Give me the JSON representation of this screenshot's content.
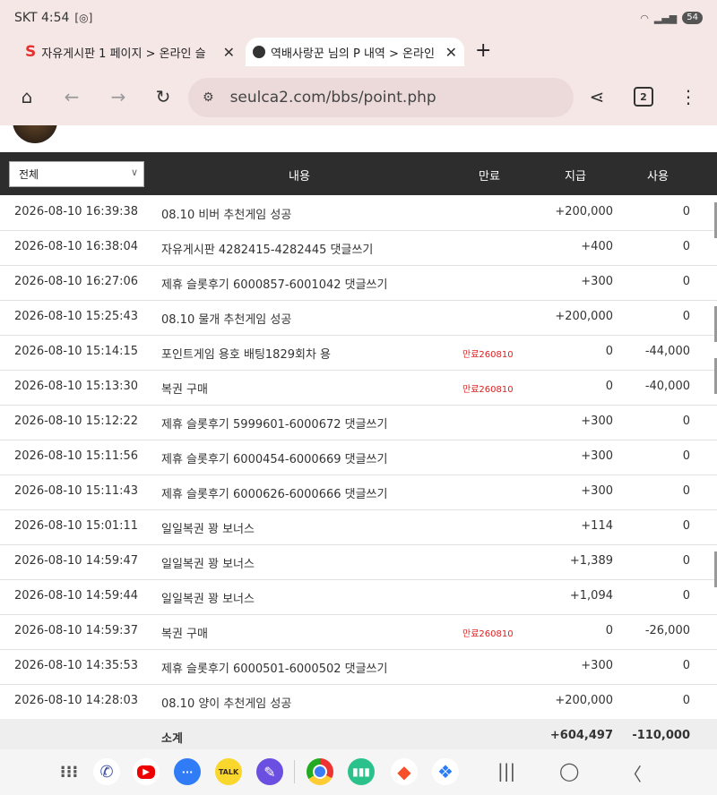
{
  "status": {
    "carrier_time": "SKT 4:54",
    "battery": "54"
  },
  "tabs": [
    {
      "title": "자유게시판 1 페이지 > 온라인 슬",
      "close": "✕"
    },
    {
      "title": "역배사랑꾼 님의 P 내역 > 온라인",
      "close": "✕"
    }
  ],
  "newtab": "+",
  "toolbar": {
    "url": "seulca2.com/bbs/point.php",
    "tab_count": "2"
  },
  "table": {
    "filter_selected": "전체",
    "headers": {
      "desc": "내용",
      "expire": "만료",
      "give": "지급",
      "use": "사용"
    },
    "rows": [
      {
        "date": "2026-08-10 16:39:38",
        "desc": "08.10 비버 추천게임 성공",
        "expire": "",
        "give": "+200,000",
        "use": "0"
      },
      {
        "date": "2026-08-10 16:38:04",
        "desc": "자유게시판 4282415-4282445 댓글쓰기",
        "expire": "",
        "give": "+400",
        "use": "0"
      },
      {
        "date": "2026-08-10 16:27:06",
        "desc": "제휴 슬롯후기 6000857-6001042 댓글쓰기",
        "expire": "",
        "give": "+300",
        "use": "0"
      },
      {
        "date": "2026-08-10 15:25:43",
        "desc": "08.10 물개 추천게임 성공",
        "expire": "",
        "give": "+200,000",
        "use": "0"
      },
      {
        "date": "2026-08-10 15:14:15",
        "desc": "포인트게임 용호 배팅1829회차 용",
        "expire": "만료260810",
        "give": "0",
        "use": "-44,000"
      },
      {
        "date": "2026-08-10 15:13:30",
        "desc": "복권 구매",
        "expire": "만료260810",
        "give": "0",
        "use": "-40,000"
      },
      {
        "date": "2026-08-10 15:12:22",
        "desc": "제휴 슬롯후기 5999601-6000672 댓글쓰기",
        "expire": "",
        "give": "+300",
        "use": "0"
      },
      {
        "date": "2026-08-10 15:11:56",
        "desc": "제휴 슬롯후기 6000454-6000669 댓글쓰기",
        "expire": "",
        "give": "+300",
        "use": "0"
      },
      {
        "date": "2026-08-10 15:11:43",
        "desc": "제휴 슬롯후기 6000626-6000666 댓글쓰기",
        "expire": "",
        "give": "+300",
        "use": "0"
      },
      {
        "date": "2026-08-10 15:01:11",
        "desc": "일일복권 꽝 보너스",
        "expire": "",
        "give": "+114",
        "use": "0"
      },
      {
        "date": "2026-08-10 14:59:47",
        "desc": "일일복권 꽝 보너스",
        "expire": "",
        "give": "+1,389",
        "use": "0"
      },
      {
        "date": "2026-08-10 14:59:44",
        "desc": "일일복권 꽝 보너스",
        "expire": "",
        "give": "+1,094",
        "use": "0"
      },
      {
        "date": "2026-08-10 14:59:37",
        "desc": "복권 구매",
        "expire": "만료260810",
        "give": "0",
        "use": "-26,000"
      },
      {
        "date": "2026-08-10 14:35:53",
        "desc": "제휴 슬롯후기 6000501-6000502 댓글쓰기",
        "expire": "",
        "give": "+300",
        "use": "0"
      },
      {
        "date": "2026-08-10 14:28:03",
        "desc": "08.10 양이 추천게임 성공",
        "expire": "",
        "give": "+200,000",
        "use": "0"
      }
    ],
    "total": {
      "label": "소계",
      "give": "+604,497",
      "use": "-110,000"
    }
  },
  "navbar": {
    "kakao_label": "TALK"
  }
}
